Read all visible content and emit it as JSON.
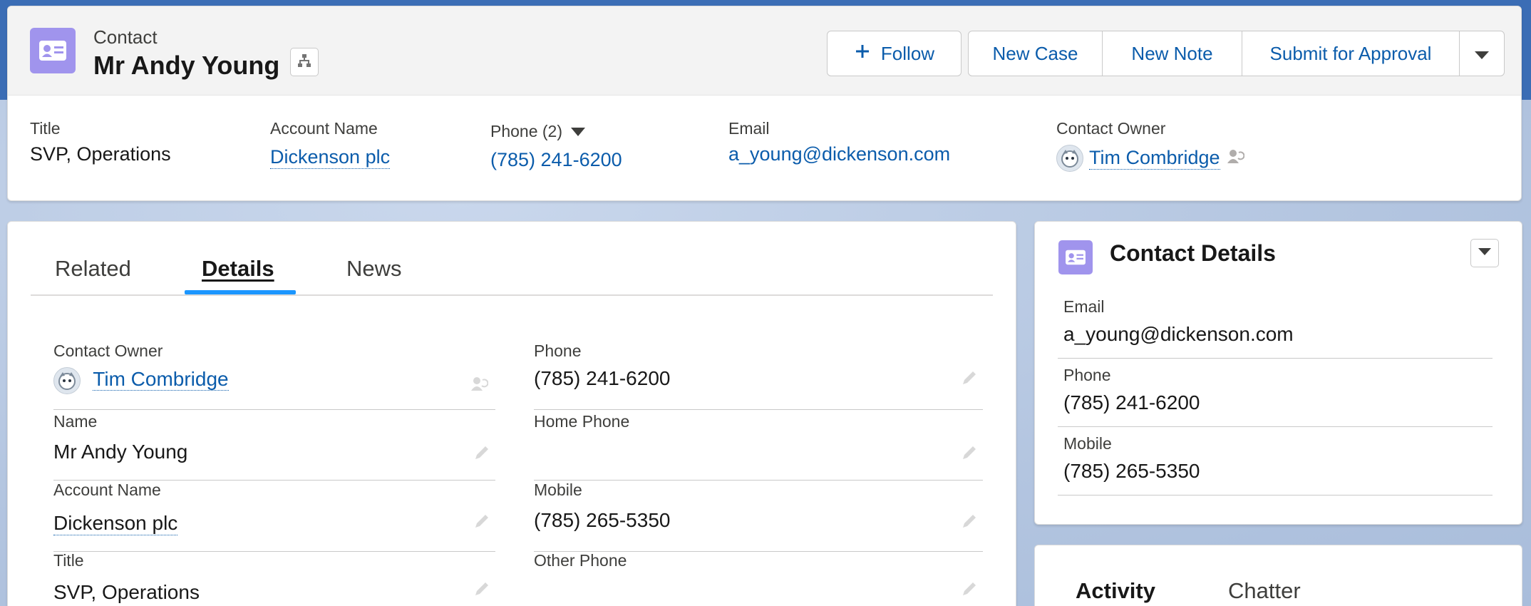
{
  "header": {
    "object_label": "Contact",
    "record_name": "Mr Andy Young",
    "actions": {
      "follow": "Follow",
      "new_case": "New Case",
      "new_note": "New Note",
      "submit_for_approval": "Submit for Approval"
    },
    "highlights": {
      "title_label": "Title",
      "title_value": "SVP, Operations",
      "account_label": "Account Name",
      "account_value": "Dickenson plc",
      "phone_label": "Phone (2)",
      "phone_value": "(785) 241-6200",
      "email_label": "Email",
      "email_value": "a_young@dickenson.com",
      "owner_label": "Contact Owner",
      "owner_value": "Tim Combridge"
    }
  },
  "tabs": {
    "related": "Related",
    "details": "Details",
    "news": "News",
    "active": "Details"
  },
  "details": {
    "contact_owner": {
      "label": "Contact Owner",
      "value": "Tim Combridge"
    },
    "name": {
      "label": "Name",
      "value": "Mr Andy Young"
    },
    "account_name": {
      "label": "Account Name",
      "value": "Dickenson plc"
    },
    "title": {
      "label": "Title",
      "value": "SVP, Operations"
    },
    "phone": {
      "label": "Phone",
      "value": "(785) 241-6200"
    },
    "home_phone": {
      "label": "Home Phone",
      "value": ""
    },
    "mobile": {
      "label": "Mobile",
      "value": "(785) 265-5350"
    },
    "other_phone": {
      "label": "Other Phone",
      "value": ""
    }
  },
  "contact_details": {
    "title": "Contact Details",
    "email": {
      "label": "Email",
      "value": "a_young@dickenson.com"
    },
    "phone": {
      "label": "Phone",
      "value": "(785) 241-6200"
    },
    "mobile": {
      "label": "Mobile",
      "value": "(785) 265-5350"
    }
  },
  "activity": {
    "activity_tab": "Activity",
    "chatter_tab": "Chatter"
  },
  "colors": {
    "brand_blue": "#0b5cab",
    "contact_icon": "#a094ed",
    "tab_indicator": "#1b96ff"
  }
}
